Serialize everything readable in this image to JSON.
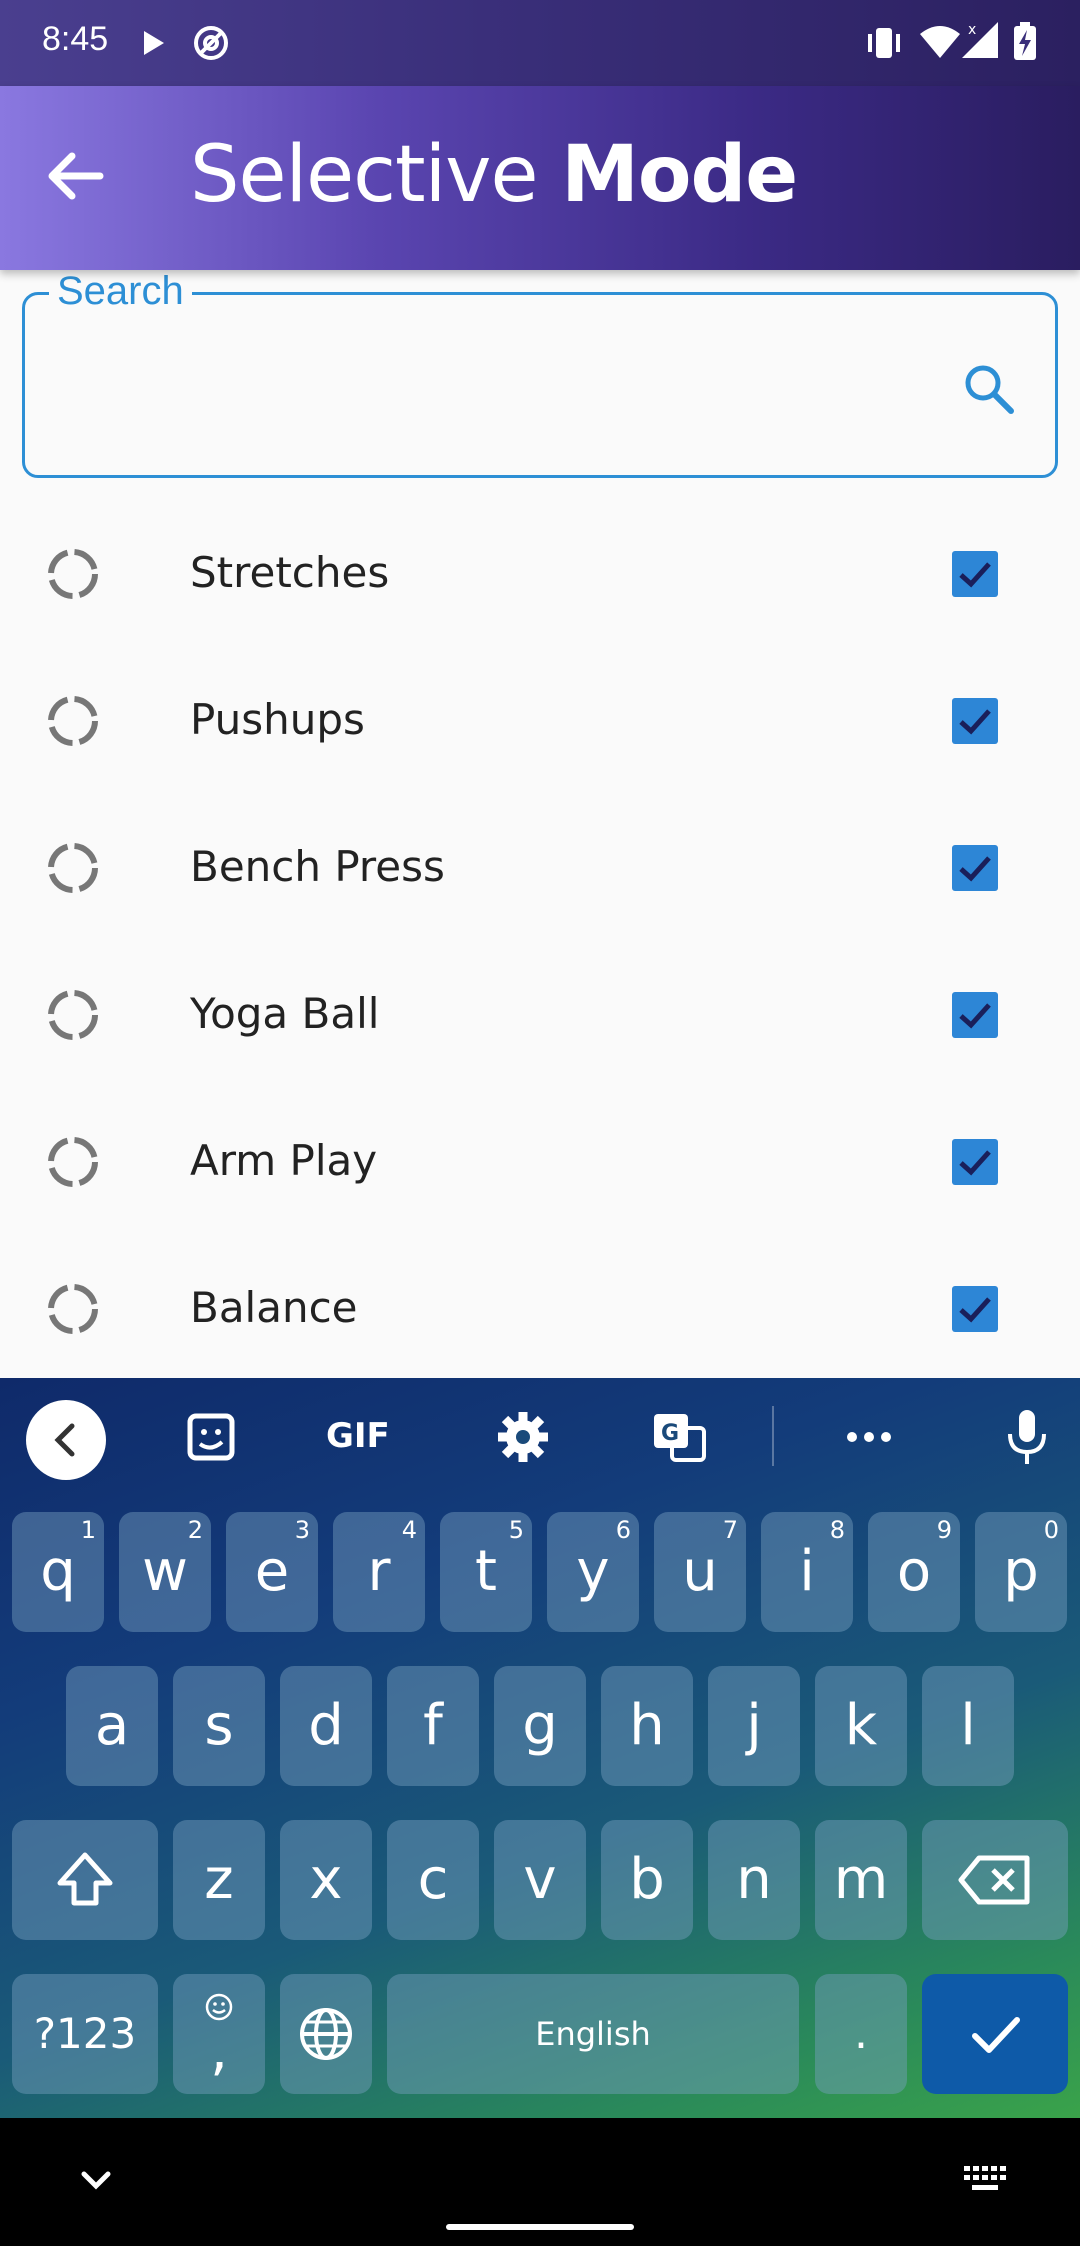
{
  "status_bar": {
    "time": "8:45"
  },
  "app_bar": {
    "title_light": "Selective ",
    "title_bold": "Mode"
  },
  "search": {
    "legend": "Search",
    "value": "",
    "placeholder": ""
  },
  "items": [
    {
      "label": "Stretches",
      "checked": true
    },
    {
      "label": "Pushups",
      "checked": true
    },
    {
      "label": "Bench Press",
      "checked": true
    },
    {
      "label": "Yoga Ball",
      "checked": true
    },
    {
      "label": "Arm Play",
      "checked": true
    },
    {
      "label": "Balance",
      "checked": true
    }
  ],
  "keyboard": {
    "toolbar": {
      "gif": "GIF"
    },
    "row1": [
      {
        "k": "q",
        "h": "1"
      },
      {
        "k": "w",
        "h": "2"
      },
      {
        "k": "e",
        "h": "3"
      },
      {
        "k": "r",
        "h": "4"
      },
      {
        "k": "t",
        "h": "5"
      },
      {
        "k": "y",
        "h": "6"
      },
      {
        "k": "u",
        "h": "7"
      },
      {
        "k": "i",
        "h": "8"
      },
      {
        "k": "o",
        "h": "9"
      },
      {
        "k": "p",
        "h": "0"
      }
    ],
    "row2": [
      "a",
      "s",
      "d",
      "f",
      "g",
      "h",
      "j",
      "k",
      "l"
    ],
    "row3": [
      "z",
      "x",
      "c",
      "v",
      "b",
      "n",
      "m"
    ],
    "symbols": "?123",
    "emoji_comma": ",",
    "space": "English",
    "period": "."
  },
  "colors": {
    "accent": "#2d8fd5",
    "checkbox": "#2d86d6",
    "check_mark": "#1a1f5a",
    "enter": "#0e5aa8"
  }
}
